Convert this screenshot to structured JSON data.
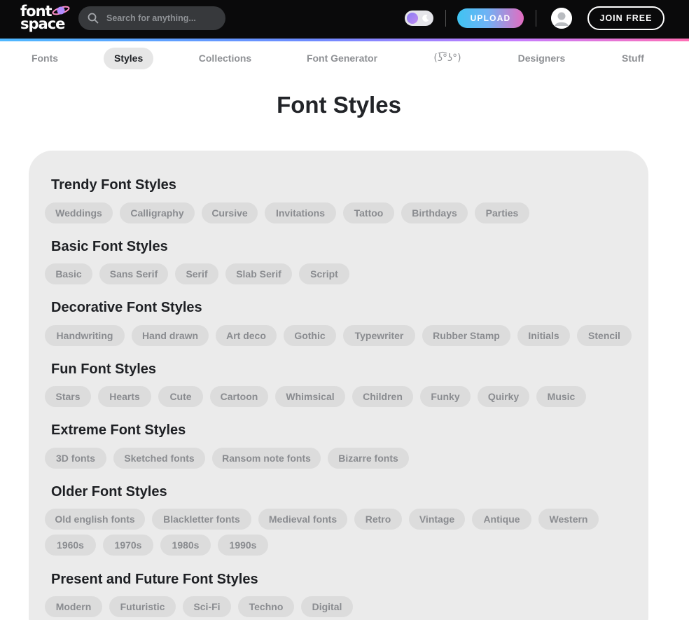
{
  "header": {
    "logo_line1": "font",
    "logo_line2": "space",
    "search_placeholder": "Search for anything...",
    "upload_label": "UPLOAD",
    "join_label": "JOIN FREE",
    "colors": {
      "background": "#0a0a0b",
      "accent_start": "#3fc4f2",
      "accent_end": "#e36cc0"
    }
  },
  "nav": {
    "items": [
      {
        "label": "Fonts"
      },
      {
        "label": "Styles",
        "active": true
      },
      {
        "label": "Collections"
      },
      {
        "label": "Font Generator"
      },
      {
        "label": "(ʖ͡°ʖ°)"
      },
      {
        "label": "Designers"
      },
      {
        "label": "Stuff"
      }
    ]
  },
  "page_title": "Font Styles",
  "sections": [
    {
      "heading": "Trendy Font Styles",
      "tags": [
        "Weddings",
        "Calligraphy",
        "Cursive",
        "Invitations",
        "Tattoo",
        "Birthdays",
        "Parties"
      ]
    },
    {
      "heading": "Basic Font Styles",
      "tags": [
        "Basic",
        "Sans Serif",
        "Serif",
        "Slab Serif",
        "Script"
      ]
    },
    {
      "heading": "Decorative Font Styles",
      "tags": [
        "Handwriting",
        "Hand drawn",
        "Art deco",
        "Gothic",
        "Typewriter",
        "Rubber Stamp",
        "Initials",
        "Stencil"
      ]
    },
    {
      "heading": "Fun Font Styles",
      "tags": [
        "Stars",
        "Hearts",
        "Cute",
        "Cartoon",
        "Whimsical",
        "Children",
        "Funky",
        "Quirky",
        "Music"
      ]
    },
    {
      "heading": "Extreme Font Styles",
      "tags": [
        "3D fonts",
        "Sketched fonts",
        "Ransom note fonts",
        "Bizarre fonts"
      ]
    },
    {
      "heading": "Older Font Styles",
      "tags": [
        "Old english fonts",
        "Blackletter fonts",
        "Medieval fonts",
        "Retro",
        "Vintage",
        "Antique",
        "Western",
        "1960s",
        "1970s",
        "1980s",
        "1990s"
      ]
    },
    {
      "heading": "Present and Future Font Styles",
      "tags": [
        "Modern",
        "Futuristic",
        "Sci-Fi",
        "Techno",
        "Digital"
      ]
    }
  ]
}
